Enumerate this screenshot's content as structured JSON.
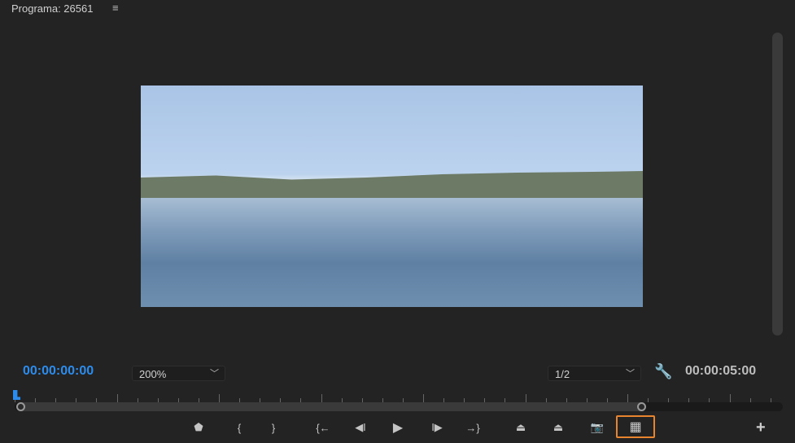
{
  "panel": {
    "title": "Programa: 26561",
    "menu_icon": "hamburger-icon"
  },
  "playback": {
    "current_timecode": "00:00:00:00",
    "duration_timecode": "00:00:05:00",
    "zoom": "200%",
    "resolution": "1/2",
    "playhead_fraction": 0.0,
    "out_point_fraction": 0.81
  },
  "colors": {
    "accent": "#2d8ceb",
    "highlight": "#e8842e"
  },
  "controls": [
    {
      "name": "add-marker",
      "icon": "marker-icon",
      "glyph": "⬟"
    },
    {
      "name": "mark-in",
      "icon": "mark-in-icon",
      "glyph": "{"
    },
    {
      "name": "mark-out",
      "icon": "mark-out-icon",
      "glyph": "}"
    },
    {
      "name": "go-to-in",
      "icon": "go-to-in-icon",
      "glyph": "{←"
    },
    {
      "name": "step-back",
      "icon": "step-back-icon",
      "glyph": "◀I"
    },
    {
      "name": "play",
      "icon": "play-icon",
      "glyph": "▶"
    },
    {
      "name": "step-forward",
      "icon": "step-forward-icon",
      "glyph": "I▶"
    },
    {
      "name": "go-to-out",
      "icon": "go-to-out-icon",
      "glyph": "→}"
    },
    {
      "name": "lift",
      "icon": "lift-icon",
      "glyph": "⏏"
    },
    {
      "name": "extract",
      "icon": "extract-icon",
      "glyph": "⏏"
    },
    {
      "name": "export-frame",
      "icon": "camera-icon",
      "glyph": "📷"
    },
    {
      "name": "comparison-view",
      "icon": "comparison-view-icon",
      "glyph": "▦"
    }
  ]
}
